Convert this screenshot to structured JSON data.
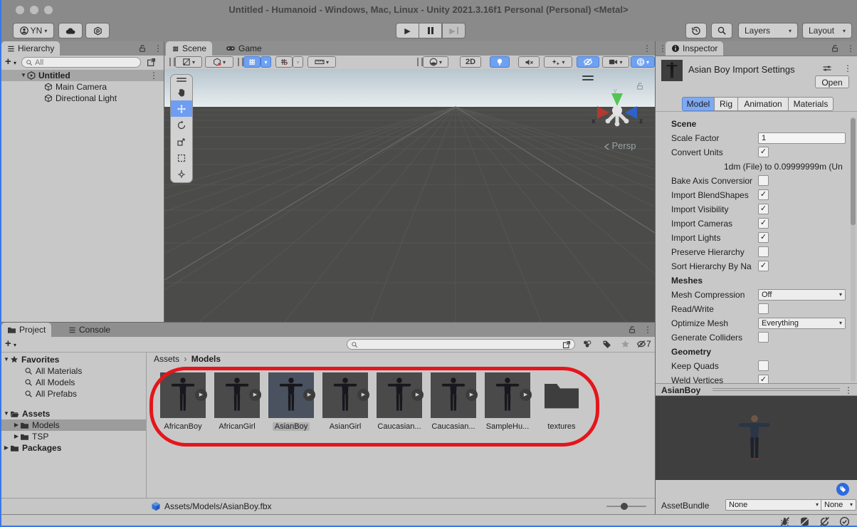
{
  "window": {
    "title": "Untitled - Humanoid - Windows, Mac, Linux - Unity 2021.3.16f1 Personal (Personal) <Metal>",
    "accent_blue": "#3b76e8",
    "annotation_red": "#e4161b"
  },
  "toolbar": {
    "account_label": "YN",
    "layers_label": "Layers",
    "layout_label": "Layout"
  },
  "hierarchy": {
    "tab_label": "Hierarchy",
    "search_placeholder": "All",
    "scene_name": "Untitled",
    "items": [
      {
        "name": "Main Camera"
      },
      {
        "name": "Directional Light"
      }
    ]
  },
  "scene": {
    "tab_scene": "Scene",
    "tab_game": "Game",
    "btn_2d": "2D",
    "persp_label": "Persp",
    "axis_x": "x",
    "axis_y": "y",
    "axis_z": "z"
  },
  "inspector": {
    "tab_label": "Inspector",
    "header_title": "Asian Boy Import Settings",
    "open_button": "Open",
    "tabs": [
      "Model",
      "Rig",
      "Animation",
      "Materials"
    ],
    "active_tab": "Model",
    "rows": [
      {
        "kind": "header",
        "label": "Scene"
      },
      {
        "kind": "text",
        "label": "Scale Factor",
        "value": "1"
      },
      {
        "kind": "checkbox",
        "label": "Convert Units",
        "checked": true
      },
      {
        "kind": "note",
        "label": "1dm (File) to 0.09999999m (Un"
      },
      {
        "kind": "checkbox",
        "label": "Bake Axis Conversior",
        "checked": false
      },
      {
        "kind": "checkbox",
        "label": "Import BlendShapes",
        "checked": true
      },
      {
        "kind": "checkbox",
        "label": "Import Visibility",
        "checked": true
      },
      {
        "kind": "checkbox",
        "label": "Import Cameras",
        "checked": true
      },
      {
        "kind": "checkbox",
        "label": "Import Lights",
        "checked": true
      },
      {
        "kind": "checkbox",
        "label": "Preserve Hierarchy",
        "checked": false
      },
      {
        "kind": "checkbox",
        "label": "Sort Hierarchy By Na",
        "checked": true
      },
      {
        "kind": "header",
        "label": "Meshes"
      },
      {
        "kind": "dropdown",
        "label": "Mesh Compression",
        "value": "Off"
      },
      {
        "kind": "checkbox",
        "label": "Read/Write",
        "checked": false
      },
      {
        "kind": "dropdown",
        "label": "Optimize Mesh",
        "value": "Everything"
      },
      {
        "kind": "checkbox",
        "label": "Generate Colliders",
        "checked": false
      },
      {
        "kind": "header",
        "label": "Geometry"
      },
      {
        "kind": "checkbox",
        "label": "Keep Quads",
        "checked": false
      },
      {
        "kind": "checkbox",
        "label": "Weld Vertices",
        "checked": true
      }
    ],
    "preview_title": "AsianBoy",
    "assetbundle": {
      "label": "AssetBundle",
      "bundle": "None",
      "variant": "None"
    }
  },
  "project": {
    "tab_project": "Project",
    "tab_console": "Console",
    "favorites": {
      "label": "Favorites",
      "items": [
        "All Materials",
        "All Models",
        "All Prefabs"
      ]
    },
    "folders": [
      {
        "label": "Assets",
        "depth": 0,
        "bold": true,
        "expanded": true,
        "icon": "folder-open",
        "selected": false
      },
      {
        "label": "Models",
        "depth": 1,
        "bold": false,
        "expanded": false,
        "icon": "folder",
        "selected": true
      },
      {
        "label": "TSP",
        "depth": 1,
        "bold": false,
        "expanded": false,
        "icon": "folder",
        "selected": false
      },
      {
        "label": "Packages",
        "depth": 0,
        "bold": true,
        "expanded": false,
        "icon": "folder",
        "selected": false
      }
    ],
    "breadcrumb": [
      "Assets",
      "Models"
    ],
    "assets": [
      {
        "label": "AfricanBoy",
        "type": "model",
        "selected": false
      },
      {
        "label": "AfricanGirl",
        "type": "model",
        "selected": false
      },
      {
        "label": "AsianBoy",
        "type": "model",
        "selected": true
      },
      {
        "label": "AsianGirl",
        "type": "model",
        "selected": false
      },
      {
        "label": "Caucasian...",
        "type": "model",
        "selected": false
      },
      {
        "label": "Caucasian...",
        "type": "model",
        "selected": false
      },
      {
        "label": "SampleHu...",
        "type": "model",
        "selected": false
      },
      {
        "label": "textures",
        "type": "folder",
        "selected": false
      }
    ],
    "selected_path": "Assets/Models/AsianBoy.fbx",
    "hidden_count": "7"
  }
}
